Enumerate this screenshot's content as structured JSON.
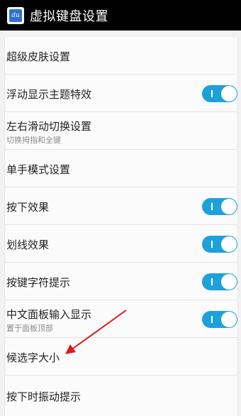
{
  "header": {
    "title": "虚拟键盘设置",
    "icon_text": "du",
    "icon": "keyboard-app-icon"
  },
  "settings": {
    "items": [
      {
        "label": "超级皮肤设置"
      },
      {
        "label": "浮动显示主题特效",
        "toggle": true
      },
      {
        "label": "左右滑动切换设置",
        "sub": "切换拇指和全键"
      },
      {
        "label": "单手模式设置"
      },
      {
        "label": "按下效果",
        "toggle": true
      },
      {
        "label": "划线效果",
        "toggle": true
      },
      {
        "label": "按键字符提示",
        "toggle": true
      },
      {
        "label": "中文面板输入显示",
        "sub": "置于面板顶部",
        "toggle": true
      },
      {
        "label": "候选字大小"
      },
      {
        "label": "按下时振动提示"
      }
    ]
  },
  "colors": {
    "toggle_on": "#1ea1d9",
    "annotation_arrow": "#e0191c",
    "title_bar": "#000000"
  }
}
